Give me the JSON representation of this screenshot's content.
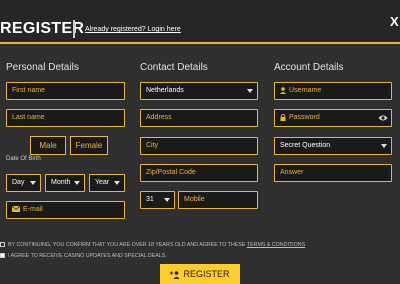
{
  "header": {
    "title": "REGISTER",
    "login_link": "Already registered? Login here",
    "close": "X"
  },
  "columns": {
    "personal": "Personal Details",
    "contact": "Contact Details",
    "account": "Account Details"
  },
  "personal": {
    "first_name": "First name",
    "last_name": "Last name",
    "male": "Male",
    "female": "Female",
    "dob_label": "Date Of Birth",
    "day": "Day",
    "month": "Month",
    "year": "Year",
    "email": "E-mail"
  },
  "contact": {
    "country": "Netherlands",
    "address": "Address",
    "city": "City",
    "zip": "Zip/Postal Code",
    "phone_code": "31",
    "mobile": "Mobile"
  },
  "account": {
    "username": "Username",
    "password": "Password",
    "secret_question": "Secret Question",
    "answer": "Answer"
  },
  "consents": {
    "age_text": "BY CONTINUING, YOU CONFIRM THAT YOU ARE OVER 18 YEARS OLD AND AGREE TO THESE",
    "terms_link": "TERMS & CONDITIONS",
    "updates_text": "I AGREE TO RECEIVE CASINO UPDATES AND SPECIAL DEALS."
  },
  "submit": "REGISTER",
  "colors": {
    "accent": "#e7b53b",
    "button": "#ffcc2e",
    "background": "#2f2f2f",
    "field": "#1a1a1a"
  }
}
